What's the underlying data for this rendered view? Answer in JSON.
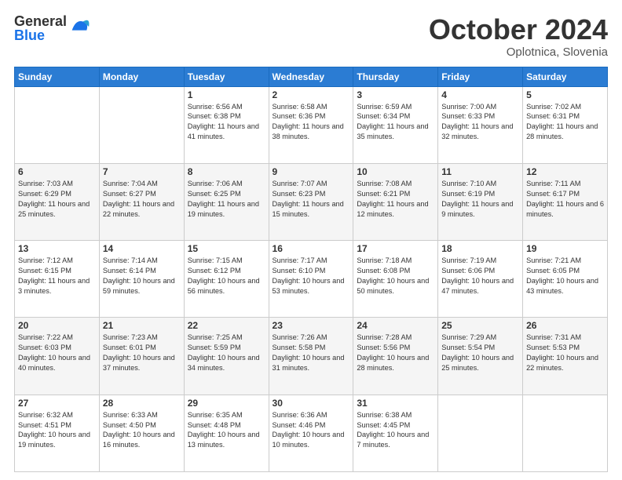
{
  "header": {
    "logo_general": "General",
    "logo_blue": "Blue",
    "month_title": "October 2024",
    "location": "Oplotnica, Slovenia"
  },
  "days_of_week": [
    "Sunday",
    "Monday",
    "Tuesday",
    "Wednesday",
    "Thursday",
    "Friday",
    "Saturday"
  ],
  "weeks": [
    [
      {
        "day": "",
        "info": ""
      },
      {
        "day": "",
        "info": ""
      },
      {
        "day": "1",
        "info": "Sunrise: 6:56 AM\nSunset: 6:38 PM\nDaylight: 11 hours and 41 minutes."
      },
      {
        "day": "2",
        "info": "Sunrise: 6:58 AM\nSunset: 6:36 PM\nDaylight: 11 hours and 38 minutes."
      },
      {
        "day": "3",
        "info": "Sunrise: 6:59 AM\nSunset: 6:34 PM\nDaylight: 11 hours and 35 minutes."
      },
      {
        "day": "4",
        "info": "Sunrise: 7:00 AM\nSunset: 6:33 PM\nDaylight: 11 hours and 32 minutes."
      },
      {
        "day": "5",
        "info": "Sunrise: 7:02 AM\nSunset: 6:31 PM\nDaylight: 11 hours and 28 minutes."
      }
    ],
    [
      {
        "day": "6",
        "info": "Sunrise: 7:03 AM\nSunset: 6:29 PM\nDaylight: 11 hours and 25 minutes."
      },
      {
        "day": "7",
        "info": "Sunrise: 7:04 AM\nSunset: 6:27 PM\nDaylight: 11 hours and 22 minutes."
      },
      {
        "day": "8",
        "info": "Sunrise: 7:06 AM\nSunset: 6:25 PM\nDaylight: 11 hours and 19 minutes."
      },
      {
        "day": "9",
        "info": "Sunrise: 7:07 AM\nSunset: 6:23 PM\nDaylight: 11 hours and 15 minutes."
      },
      {
        "day": "10",
        "info": "Sunrise: 7:08 AM\nSunset: 6:21 PM\nDaylight: 11 hours and 12 minutes."
      },
      {
        "day": "11",
        "info": "Sunrise: 7:10 AM\nSunset: 6:19 PM\nDaylight: 11 hours and 9 minutes."
      },
      {
        "day": "12",
        "info": "Sunrise: 7:11 AM\nSunset: 6:17 PM\nDaylight: 11 hours and 6 minutes."
      }
    ],
    [
      {
        "day": "13",
        "info": "Sunrise: 7:12 AM\nSunset: 6:15 PM\nDaylight: 11 hours and 3 minutes."
      },
      {
        "day": "14",
        "info": "Sunrise: 7:14 AM\nSunset: 6:14 PM\nDaylight: 10 hours and 59 minutes."
      },
      {
        "day": "15",
        "info": "Sunrise: 7:15 AM\nSunset: 6:12 PM\nDaylight: 10 hours and 56 minutes."
      },
      {
        "day": "16",
        "info": "Sunrise: 7:17 AM\nSunset: 6:10 PM\nDaylight: 10 hours and 53 minutes."
      },
      {
        "day": "17",
        "info": "Sunrise: 7:18 AM\nSunset: 6:08 PM\nDaylight: 10 hours and 50 minutes."
      },
      {
        "day": "18",
        "info": "Sunrise: 7:19 AM\nSunset: 6:06 PM\nDaylight: 10 hours and 47 minutes."
      },
      {
        "day": "19",
        "info": "Sunrise: 7:21 AM\nSunset: 6:05 PM\nDaylight: 10 hours and 43 minutes."
      }
    ],
    [
      {
        "day": "20",
        "info": "Sunrise: 7:22 AM\nSunset: 6:03 PM\nDaylight: 10 hours and 40 minutes."
      },
      {
        "day": "21",
        "info": "Sunrise: 7:23 AM\nSunset: 6:01 PM\nDaylight: 10 hours and 37 minutes."
      },
      {
        "day": "22",
        "info": "Sunrise: 7:25 AM\nSunset: 5:59 PM\nDaylight: 10 hours and 34 minutes."
      },
      {
        "day": "23",
        "info": "Sunrise: 7:26 AM\nSunset: 5:58 PM\nDaylight: 10 hours and 31 minutes."
      },
      {
        "day": "24",
        "info": "Sunrise: 7:28 AM\nSunset: 5:56 PM\nDaylight: 10 hours and 28 minutes."
      },
      {
        "day": "25",
        "info": "Sunrise: 7:29 AM\nSunset: 5:54 PM\nDaylight: 10 hours and 25 minutes."
      },
      {
        "day": "26",
        "info": "Sunrise: 7:31 AM\nSunset: 5:53 PM\nDaylight: 10 hours and 22 minutes."
      }
    ],
    [
      {
        "day": "27",
        "info": "Sunrise: 6:32 AM\nSunset: 4:51 PM\nDaylight: 10 hours and 19 minutes."
      },
      {
        "day": "28",
        "info": "Sunrise: 6:33 AM\nSunset: 4:50 PM\nDaylight: 10 hours and 16 minutes."
      },
      {
        "day": "29",
        "info": "Sunrise: 6:35 AM\nSunset: 4:48 PM\nDaylight: 10 hours and 13 minutes."
      },
      {
        "day": "30",
        "info": "Sunrise: 6:36 AM\nSunset: 4:46 PM\nDaylight: 10 hours and 10 minutes."
      },
      {
        "day": "31",
        "info": "Sunrise: 6:38 AM\nSunset: 4:45 PM\nDaylight: 10 hours and 7 minutes."
      },
      {
        "day": "",
        "info": ""
      },
      {
        "day": "",
        "info": ""
      }
    ]
  ]
}
